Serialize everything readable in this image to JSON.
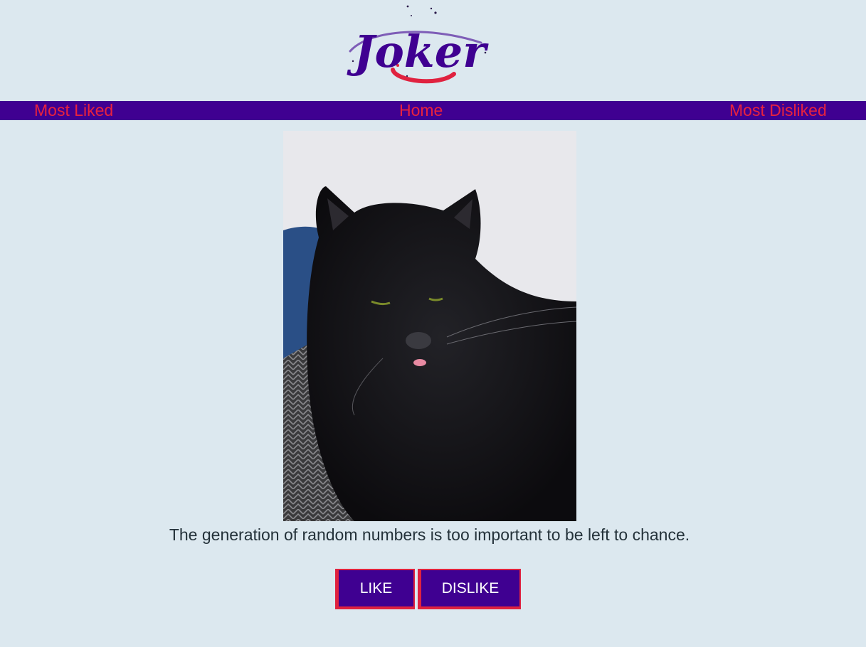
{
  "logo": {
    "text": "Joker",
    "colors": {
      "primary": "#3f0091",
      "accent": "#e0223f"
    }
  },
  "nav": {
    "most_liked": "Most Liked",
    "home": "Home",
    "most_disliked": "Most Disliked"
  },
  "joke": {
    "text": "The generation of random numbers is too important to be left to chance."
  },
  "buttons": {
    "like": "LIKE",
    "dislike": "DISLIKE"
  },
  "colors": {
    "background": "#dce8ef",
    "nav_background": "#3f0091",
    "nav_link": "#e8223e",
    "button_bg": "#3f0091",
    "button_border": "#e0223f"
  }
}
